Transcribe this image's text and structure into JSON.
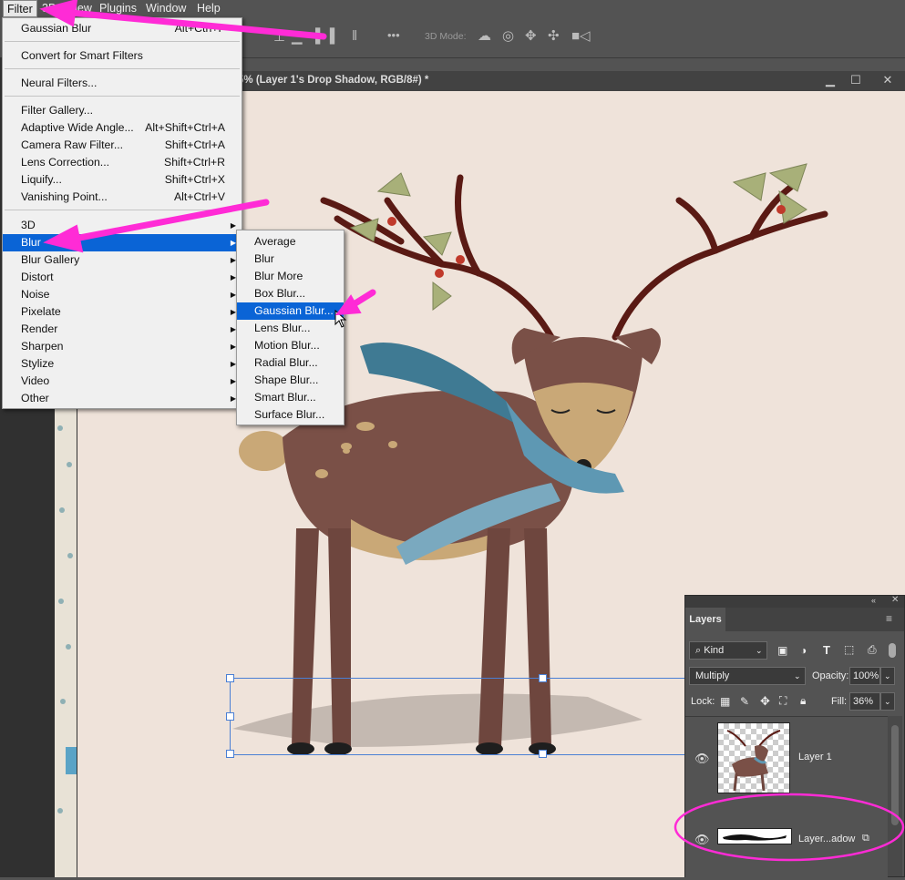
{
  "menubar": {
    "items": [
      "Filter",
      "3D",
      "View",
      "Plugins",
      "Window",
      "Help"
    ]
  },
  "options_bar": {
    "mode_label": "3D Mode:",
    "more_label": "•••"
  },
  "document": {
    "title": "5% (Layer 1's Drop Shadow, RGB/8#) *",
    "min_glyph": "▁",
    "max_glyph": "☐",
    "close_glyph": "✕"
  },
  "filter_menu": {
    "last_filter": "Gaussian Blur",
    "last_filter_shortcut": "Alt+Ctrl+F",
    "convert_smart": "Convert for Smart Filters",
    "neural": "Neural Filters...",
    "group_items": [
      {
        "label": "Filter Gallery...",
        "shortcut": ""
      },
      {
        "label": "Adaptive Wide Angle...",
        "shortcut": "Alt+Shift+Ctrl+A"
      },
      {
        "label": "Camera Raw Filter...",
        "shortcut": "Shift+Ctrl+A"
      },
      {
        "label": "Lens Correction...",
        "shortcut": "Shift+Ctrl+R"
      },
      {
        "label": "Liquify...",
        "shortcut": "Shift+Ctrl+X"
      },
      {
        "label": "Vanishing Point...",
        "shortcut": "Alt+Ctrl+V"
      }
    ],
    "submenus": [
      "3D",
      "Blur",
      "Blur Gallery",
      "Distort",
      "Noise",
      "Pixelate",
      "Render",
      "Sharpen",
      "Stylize",
      "Video",
      "Other"
    ],
    "highlighted": "Blur"
  },
  "blur_menu": {
    "items": [
      "Average",
      "Blur",
      "Blur More",
      "Box Blur...",
      "Gaussian Blur...",
      "Lens Blur...",
      "Motion Blur...",
      "Radial Blur...",
      "Shape Blur...",
      "Smart Blur...",
      "Surface Blur..."
    ],
    "highlighted": "Gaussian Blur..."
  },
  "layers_panel": {
    "tab": "Layers",
    "filter_kind": "Kind",
    "blend_mode": "Multiply",
    "opacity_label": "Opacity:",
    "opacity_value": "100%",
    "lock_label": "Lock:",
    "fill_label": "Fill:",
    "fill_value": "36%",
    "layers": [
      {
        "name": "Layer 1"
      },
      {
        "name": "Layer...adow"
      }
    ]
  },
  "colors": {
    "highlight": "#0a64d6",
    "annotation": "#ff2bd6",
    "canvas": "#efe3da"
  }
}
